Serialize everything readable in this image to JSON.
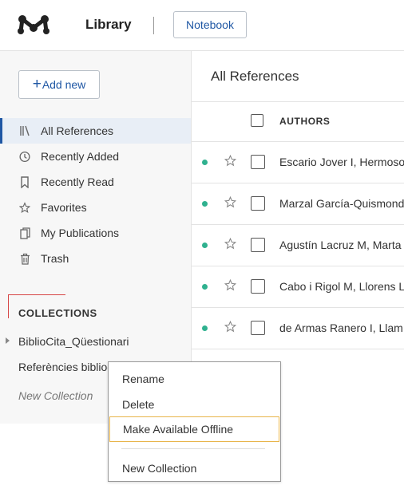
{
  "topbar": {
    "title": "Library",
    "notebook_label": "Notebook"
  },
  "sidebar": {
    "add_new_label": "Add new",
    "items": [
      {
        "label": "All References",
        "icon": "library-icon",
        "active": true
      },
      {
        "label": "Recently Added",
        "icon": "clock-icon"
      },
      {
        "label": "Recently Read",
        "icon": "bookmark-icon"
      },
      {
        "label": "Favorites",
        "icon": "star-icon"
      },
      {
        "label": "My Publications",
        "icon": "publications-icon"
      },
      {
        "label": "Trash",
        "icon": "trash-icon"
      }
    ],
    "collections_heading": "COLLECTIONS",
    "collections": [
      {
        "label": "BiblioCita_Qüestionari"
      },
      {
        "label": "Referències bibliog"
      }
    ],
    "new_collection_label": "New Collection"
  },
  "main": {
    "header": "All References",
    "column_authors": "AUTHORS",
    "rows": [
      {
        "authors": "Escario Jover I, Hermoso"
      },
      {
        "authors": "Marzal García-Quismondo"
      },
      {
        "authors": "Agustín Lacruz M, Marta"
      },
      {
        "authors": "Cabo i Rigol M, Llorens L"
      },
      {
        "authors": "de Armas Ranero I, Llam"
      }
    ]
  },
  "context_menu": {
    "items": [
      "Rename",
      "Delete",
      "Make Available Offline"
    ],
    "footer_item": "New Collection"
  },
  "colors": {
    "accent": "#1f57a4",
    "read_dot": "#2fb18f",
    "highlight": "#e8b44a"
  }
}
